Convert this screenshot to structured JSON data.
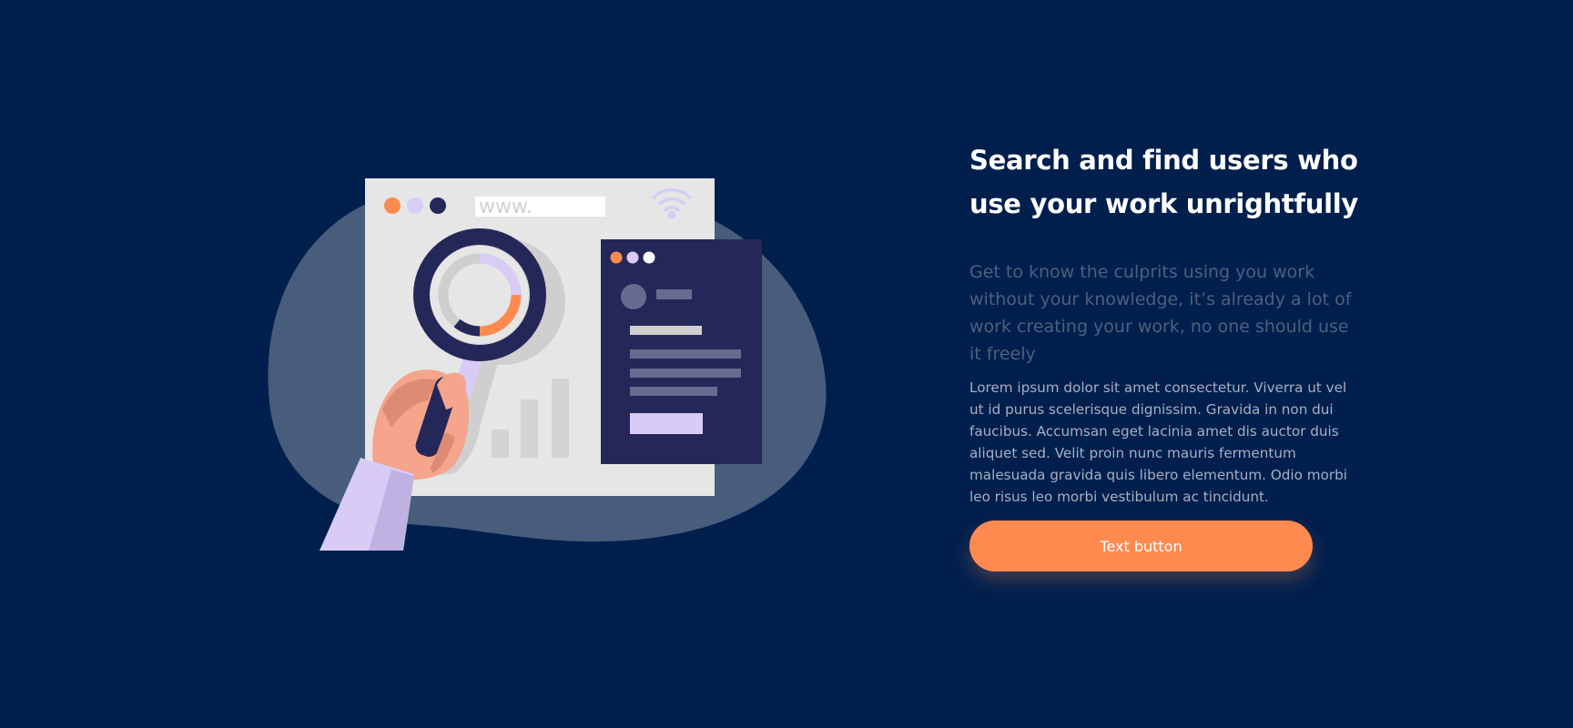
{
  "hero": {
    "headline": "Search and find users who use your work unrightfully",
    "subheadline": "Get to know the culprits using you work without your knowledge, it’s already a lot of work creating your work, no one should use it freely",
    "body": "Lorem ipsum dolor sit amet consectetur. Viverra ut vel ut id purus scelerisque dignissim. Gravida in non dui faucibus. Accumsan eget lacinia amet dis auctor duis aliquet sed. Velit proin nunc mauris fermentum malesuada gravida quis libero elementum. Odio morbi leo risus leo morbi vestibulum ac tincidunt.",
    "button_label": "Text button"
  },
  "illustration": {
    "url_text": "www.",
    "icons": [
      "search-illustration",
      "magnifier-icon",
      "wifi-icon",
      "donut-chart-icon",
      "bar-chart-icon",
      "hand-icon",
      "profile-card-icon"
    ]
  },
  "colors": {
    "background": "#001f4d",
    "accent": "#ff8a50",
    "lavender": "#d8ccf6",
    "navy": "#262759"
  }
}
